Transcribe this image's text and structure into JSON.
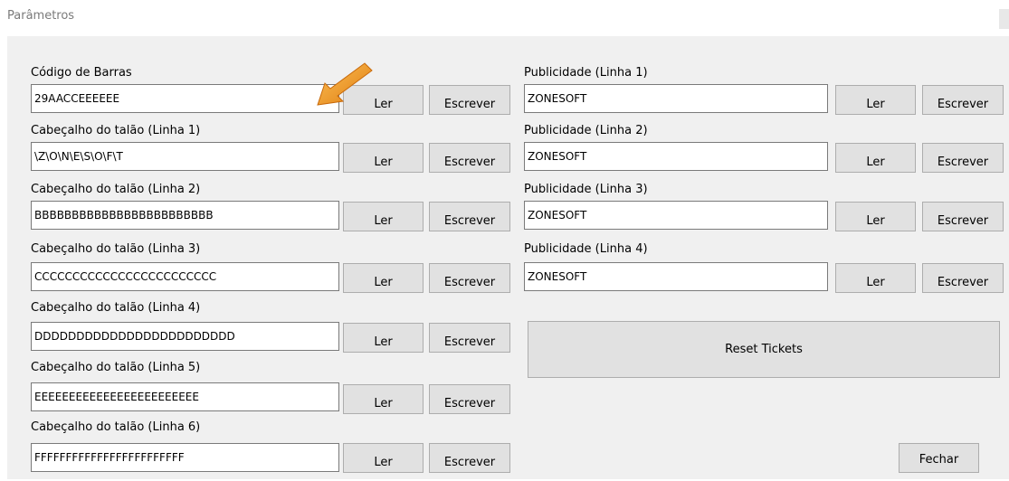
{
  "window": {
    "title": "Parâmetros"
  },
  "left": {
    "rows": [
      {
        "label": "Código de Barras",
        "value": "29AACCEEEEEE",
        "read": "Ler",
        "write": "Escrever"
      },
      {
        "label": "Cabeçalho do talão (Linha 1)",
        "value": "\\Z\\O\\N\\E\\S\\O\\F\\T",
        "read": "Ler",
        "write": "Escrever"
      },
      {
        "label": "Cabeçalho do talão (Linha 2)",
        "value": "BBBBBBBBBBBBBBBBBBBBBBBB",
        "read": "Ler",
        "write": "Escrever"
      },
      {
        "label": "Cabeçalho do talão (Linha 3)",
        "value": "CCCCCCCCCCCCCCCCCCCCCCCC",
        "read": "Ler",
        "write": "Escrever"
      },
      {
        "label": "Cabeçalho do talão (Linha 4)",
        "value": "DDDDDDDDDDDDDDDDDDDDDDDD",
        "read": "Ler",
        "write": "Escrever"
      },
      {
        "label": "Cabeçalho do talão (Linha 5)",
        "value": "EEEEEEEEEEEEEEEEEEEEEEEE",
        "read": "Ler",
        "write": "Escrever"
      },
      {
        "label": "Cabeçalho do talão (Linha 6)",
        "value": "FFFFFFFFFFFFFFFFFFFFFFFF",
        "read": "Ler",
        "write": "Escrever"
      }
    ]
  },
  "right": {
    "rows": [
      {
        "label": "Publicidade (Linha 1)",
        "value": "ZONESOFT",
        "read": "Ler",
        "write": "Escrever"
      },
      {
        "label": "Publicidade (Linha 2)",
        "value": "ZONESOFT",
        "read": "Ler",
        "write": "Escrever"
      },
      {
        "label": "Publicidade (Linha 3)",
        "value": "ZONESOFT",
        "read": "Ler",
        "write": "Escrever"
      },
      {
        "label": "Publicidade (Linha 4)",
        "value": "ZONESOFT",
        "read": "Ler",
        "write": "Escrever"
      }
    ],
    "reset_label": "Reset Tickets"
  },
  "footer": {
    "close_label": "Fechar"
  },
  "annotation": {
    "icon": "arrow-pointer-icon",
    "color": "#f39c12"
  }
}
